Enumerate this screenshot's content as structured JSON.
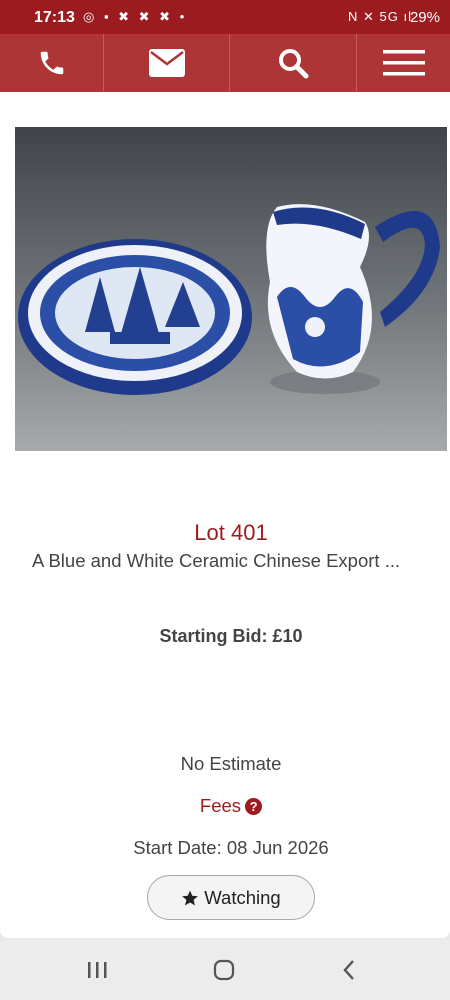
{
  "status_bar": {
    "time": "17:13",
    "notification_icons": "◎ ▪ ✖ ✖ ✖ •",
    "system_icons": "N ✕ 5G ıl",
    "battery": "29%"
  },
  "nav": {
    "phone_icon": "phone-icon",
    "mail_icon": "envelope-icon",
    "search_icon": "search-icon",
    "menu_icon": "hamburger-menu-icon"
  },
  "lot": {
    "number": "Lot 401",
    "title": "A Blue and White Ceramic Chinese Export ...",
    "starting_bid": "Starting Bid: £10",
    "estimate": "No Estimate",
    "fees_label": "Fees",
    "start_date": "Start Date: 08 Jun 2026",
    "watch_label": "Watching"
  },
  "colors": {
    "brand_dark": "#9b1b1f",
    "brand": "#ad3535"
  }
}
